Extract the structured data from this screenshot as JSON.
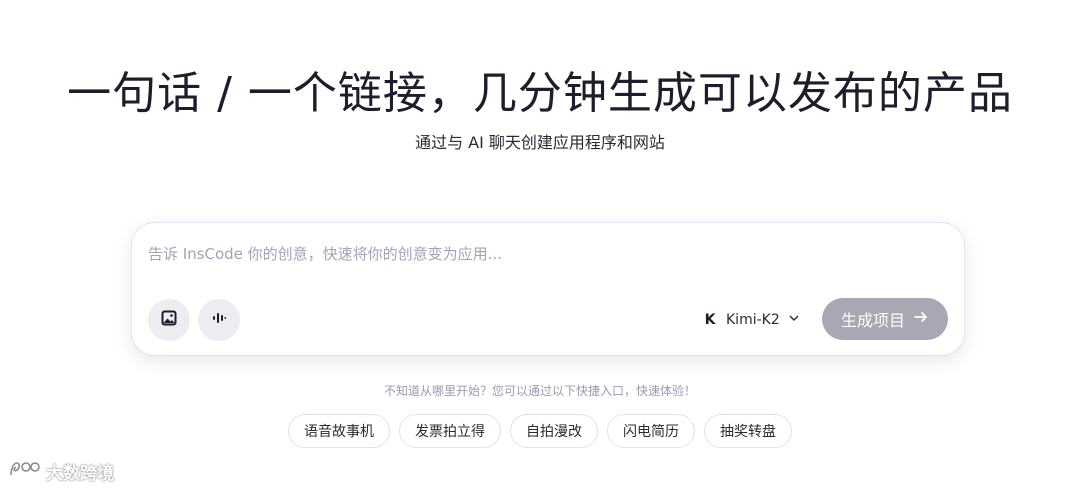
{
  "hero": {
    "title": "一句话 / 一个链接，几分钟生成可以发布的产品",
    "subtitle": "通过与 AI 聊天创建应用程序和网站"
  },
  "prompt": {
    "placeholder": "告诉 InsCode 你的创意，快速将你的创意变为应用...",
    "value": "",
    "tools": [
      {
        "icon": "image-upload-icon"
      },
      {
        "icon": "voice-waveform-icon"
      }
    ],
    "model": {
      "logo": "K",
      "label": "Kimi-K2",
      "icon": "chevron-down-icon"
    },
    "generate_label": "生成项目",
    "generate_icon": "arrow-right-icon"
  },
  "hint": "不知道从哪里开始？您可以通过以下快捷入口，快速体验！",
  "quick_entries": [
    "语音故事机",
    "发票拍立得",
    "自拍漫改",
    "闪电简历",
    "抽奖转盘"
  ],
  "watermark": "大数跨境",
  "colors": {
    "generate_button": "#a8a7b4",
    "tool_button_bg": "#ececf1",
    "placeholder": "#a3a3b8"
  }
}
